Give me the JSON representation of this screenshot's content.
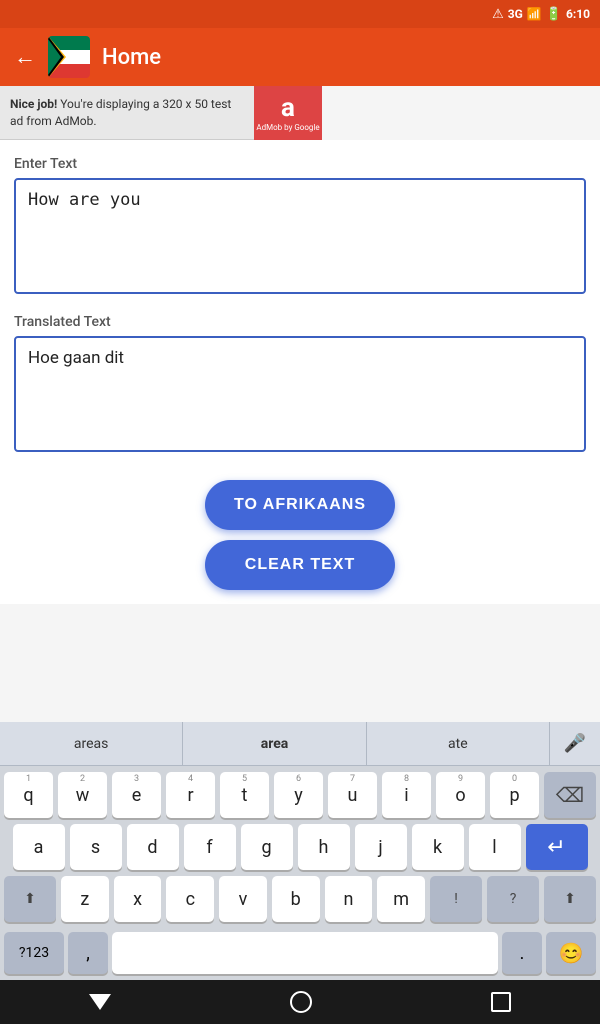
{
  "status_bar": {
    "network": "3G",
    "signal": "▂▄▆",
    "battery": "🔋",
    "time": "6:10"
  },
  "nav": {
    "title": "Home",
    "back_label": "←"
  },
  "ad": {
    "bold_text": "Nice job!",
    "body_text": " You're displaying a 320 x 50 test ad from AdMob.",
    "logo_letter": "a",
    "logo_sub": "AdMob by Google"
  },
  "main": {
    "enter_text_label": "Enter Text",
    "input_value": "How are you",
    "translated_label": "Translated Text",
    "translated_value": "Hoe gaan dit",
    "btn_translate": "TO AFRIKAANS",
    "btn_clear": "CLEAR TEXT"
  },
  "keyboard": {
    "suggestions": [
      "areas",
      "area",
      "ate"
    ],
    "rows": [
      {
        "keys": [
          {
            "label": "q",
            "num": "1"
          },
          {
            "label": "w",
            "num": "2"
          },
          {
            "label": "e",
            "num": "3"
          },
          {
            "label": "r",
            "num": "4"
          },
          {
            "label": "t",
            "num": "5"
          },
          {
            "label": "y",
            "num": "6"
          },
          {
            "label": "u",
            "num": "7"
          },
          {
            "label": "i",
            "num": "8"
          },
          {
            "label": "o",
            "num": "9"
          },
          {
            "label": "p",
            "num": "0"
          }
        ]
      },
      {
        "keys": [
          {
            "label": "a"
          },
          {
            "label": "s"
          },
          {
            "label": "d"
          },
          {
            "label": "f"
          },
          {
            "label": "g"
          },
          {
            "label": "h"
          },
          {
            "label": "j"
          },
          {
            "label": "k"
          },
          {
            "label": "l"
          }
        ]
      },
      {
        "keys": [
          {
            "label": "⬆",
            "type": "special"
          },
          {
            "label": "z"
          },
          {
            "label": "x"
          },
          {
            "label": "c"
          },
          {
            "label": "v"
          },
          {
            "label": "b"
          },
          {
            "label": "n"
          },
          {
            "label": "m"
          },
          {
            "label": "!",
            "type": "special"
          },
          {
            "label": "?",
            "type": "special"
          },
          {
            "label": "⬆",
            "type": "special"
          },
          {
            "label": "⌫",
            "type": "delete"
          }
        ]
      }
    ],
    "num_sym_label": "?123",
    "comma_label": ",",
    "period_label": ".",
    "emoji_label": "😊",
    "enter_icon": "↵"
  },
  "bottom_nav": {
    "back": "triangle",
    "home": "circle",
    "recent": "square"
  }
}
